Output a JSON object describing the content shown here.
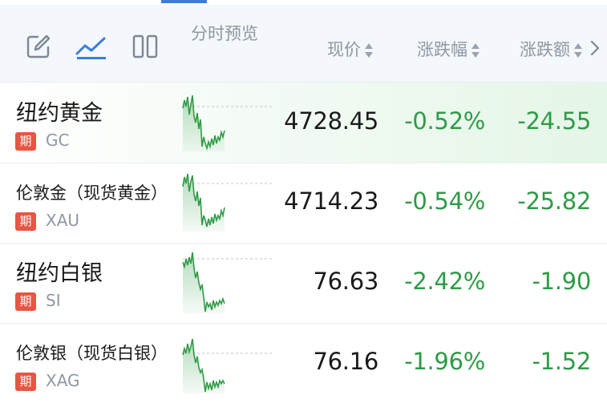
{
  "header": {
    "preview_label": "分时预览",
    "price_label": "现价",
    "change_pct_label": "涨跌幅",
    "change_amt_label": "涨跌额"
  },
  "colors": {
    "down_green": "#2e9b45",
    "futures_tag": "#e85543",
    "accent_blue": "#3b7ddd"
  },
  "rows": [
    {
      "name": "纽约黄金",
      "tag": "期",
      "code": "GC",
      "price": "4728.45",
      "change_pct": "-0.52%",
      "change_amt": "-24.55"
    },
    {
      "name": "伦敦金（现货黄金）",
      "tag": "期",
      "code": "XAU",
      "price": "4714.23",
      "change_pct": "-0.54%",
      "change_amt": "-25.82"
    },
    {
      "name": "纽约白银",
      "tag": "期",
      "code": "SI",
      "price": "76.63",
      "change_pct": "-2.42%",
      "change_amt": "-1.90"
    },
    {
      "name": "伦敦银（现货白银）",
      "tag": "期",
      "code": "XAG",
      "price": "76.16",
      "change_pct": "-1.96%",
      "change_amt": "-1.52"
    }
  ]
}
